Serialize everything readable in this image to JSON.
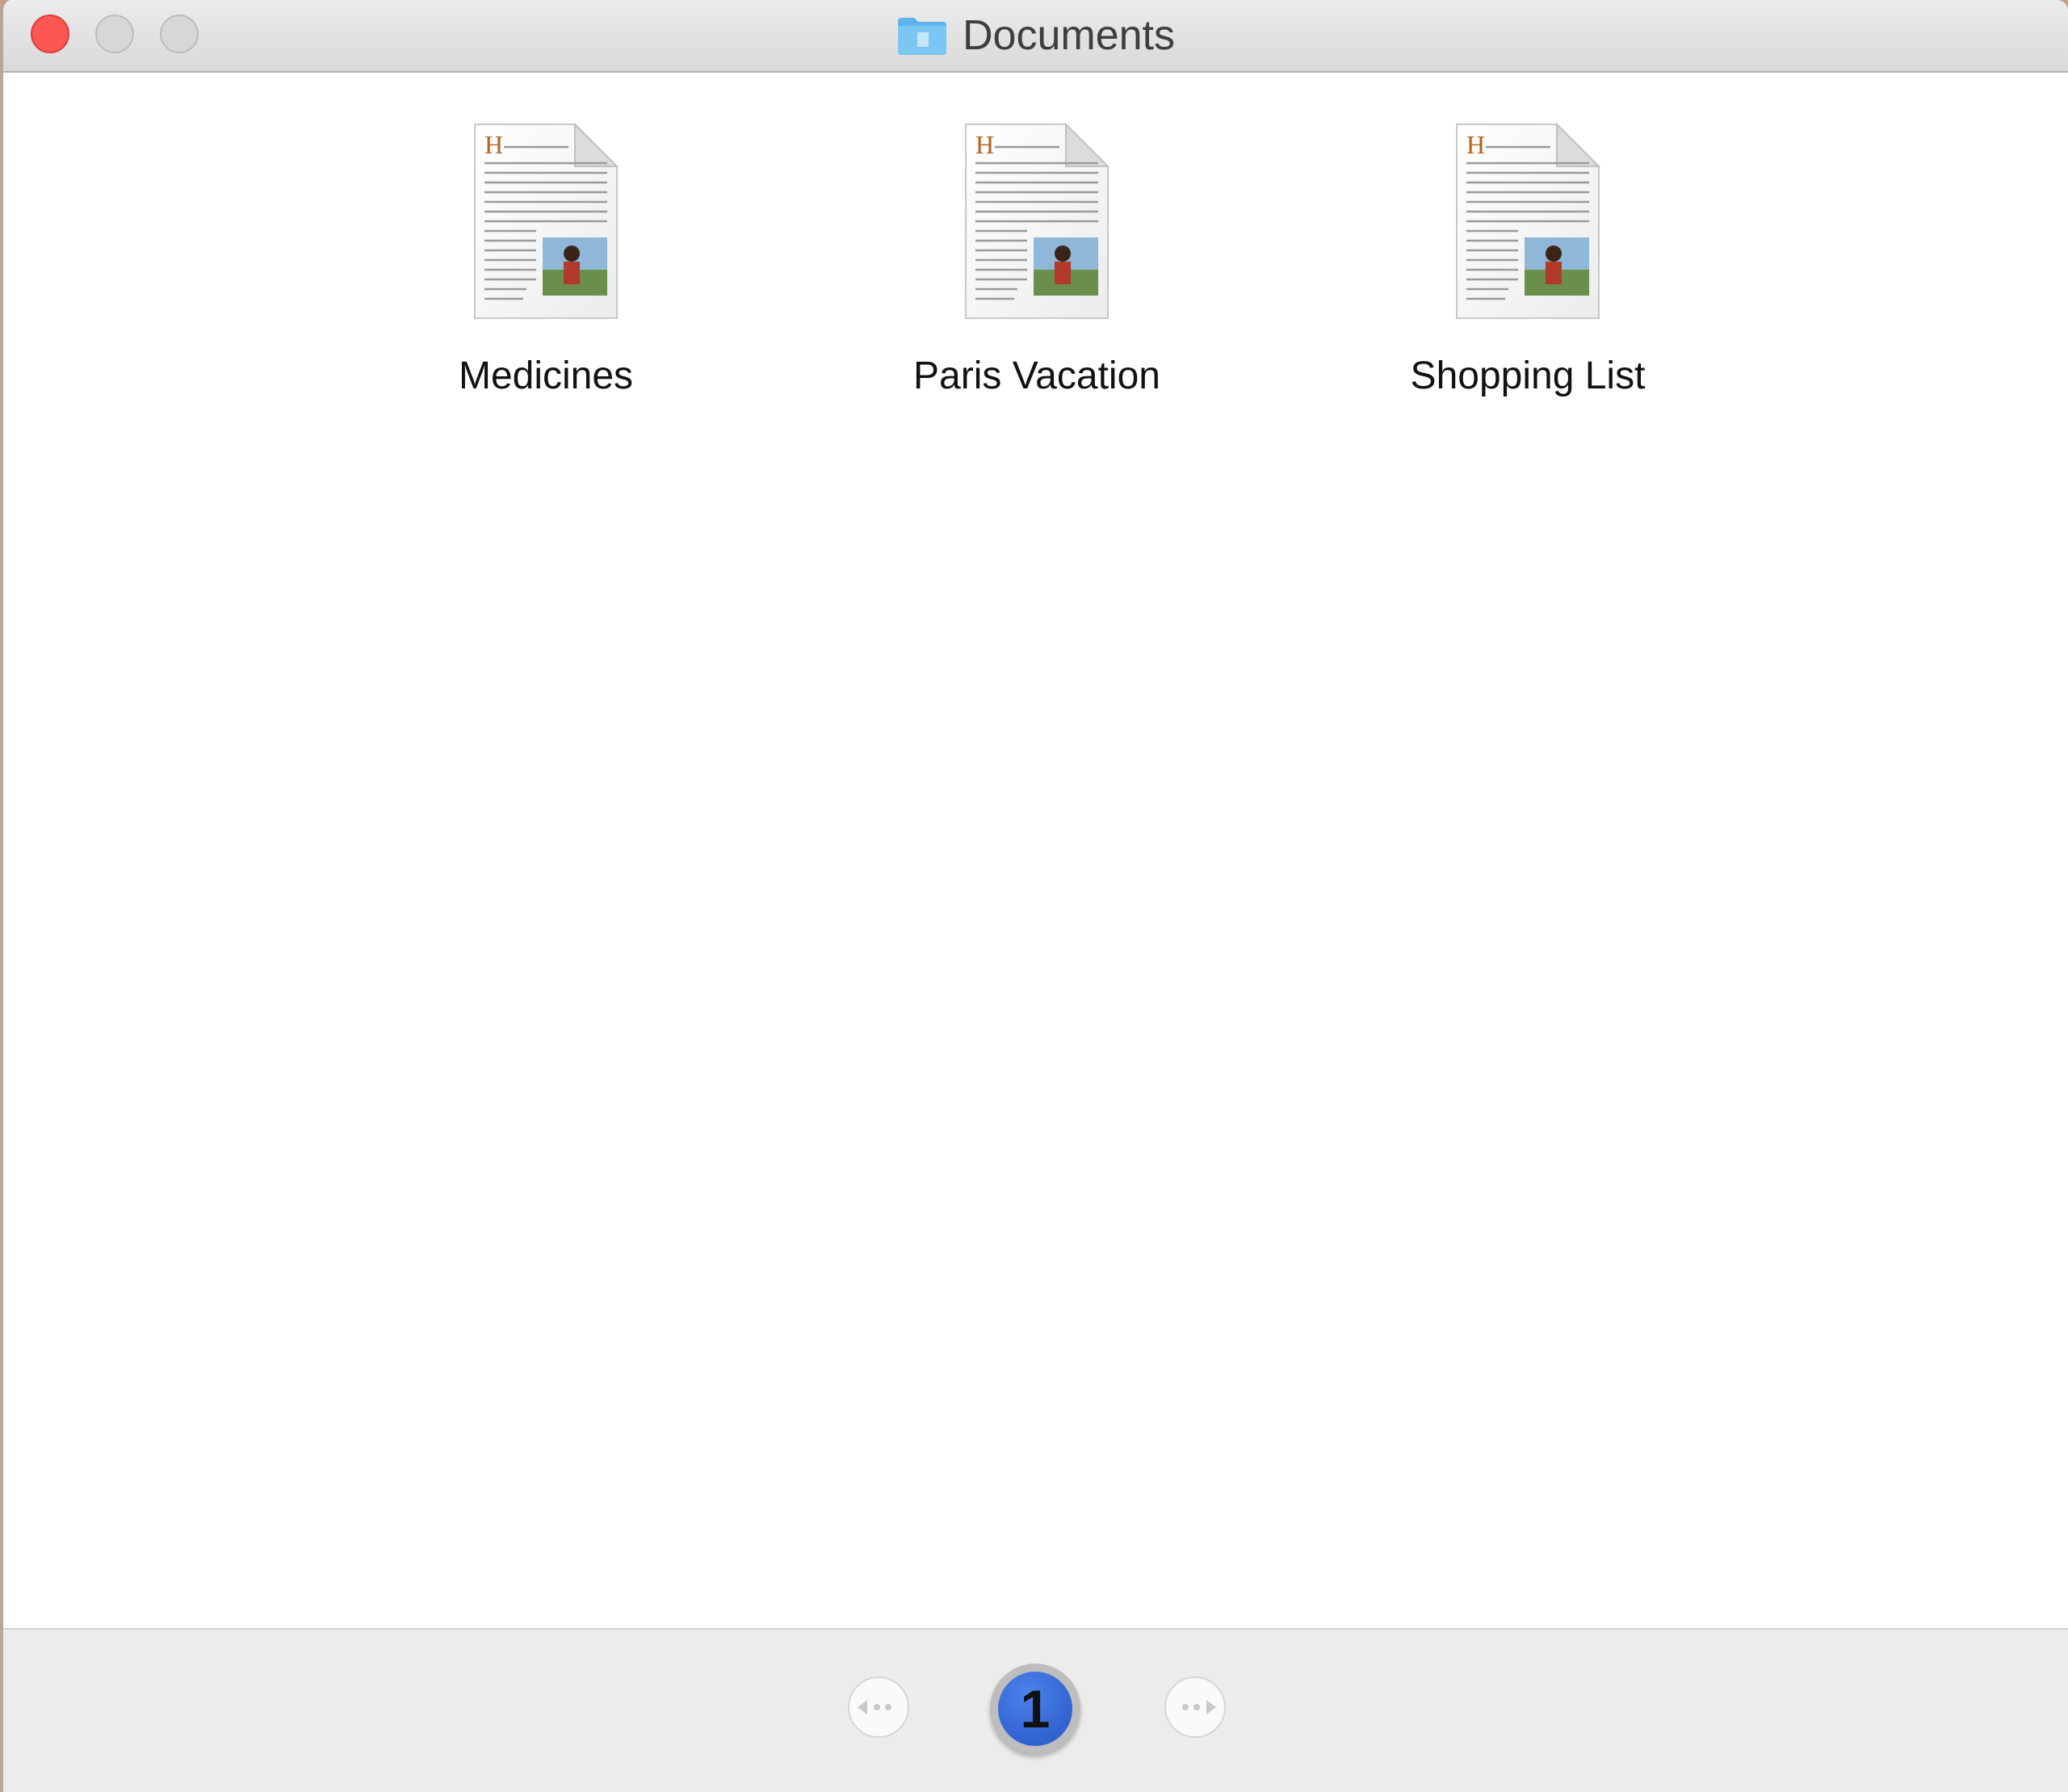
{
  "window": {
    "title": "Documents",
    "title_icon": "folder-icon"
  },
  "files": [
    {
      "name": "Medicines",
      "icon": "text-document-icon"
    },
    {
      "name": "Paris Vacation",
      "icon": "text-document-icon"
    },
    {
      "name": "Shopping List",
      "icon": "text-document-icon"
    }
  ],
  "pager": {
    "current_page": "1",
    "prev_icon": "previous-page-icon",
    "next_icon": "next-page-icon"
  },
  "colors": {
    "close": "#fc5753",
    "accent": "#2f63d6",
    "folder": "#6ab9f0"
  }
}
